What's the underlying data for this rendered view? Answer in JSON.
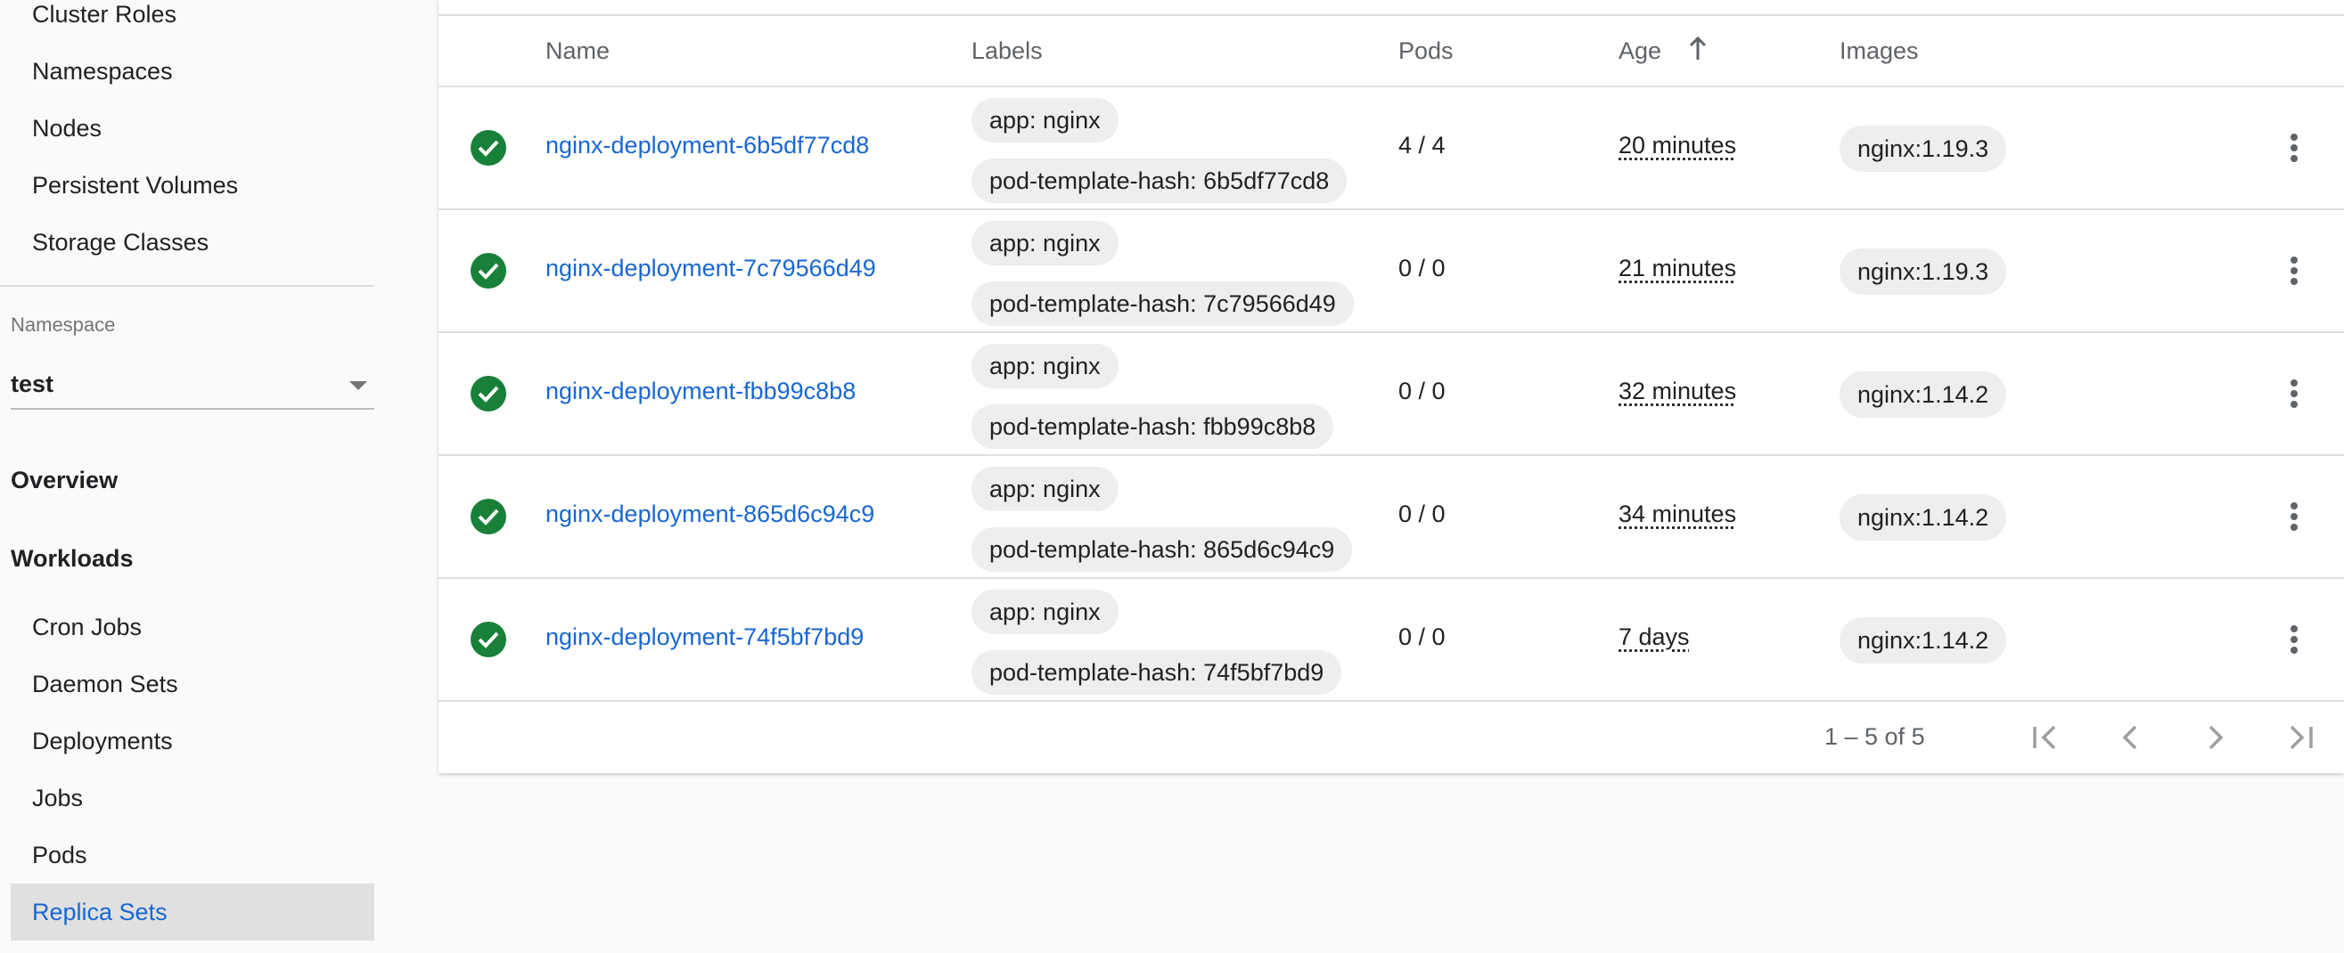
{
  "sidebar": {
    "cluster_items": [
      {
        "label": "Cluster Roles"
      },
      {
        "label": "Namespaces"
      },
      {
        "label": "Nodes"
      },
      {
        "label": "Persistent Volumes"
      },
      {
        "label": "Storage Classes"
      }
    ],
    "namespace_label": "Namespace",
    "namespace_value": "test",
    "overview_label": "Overview",
    "workloads_label": "Workloads",
    "workload_items": [
      {
        "label": "Cron Jobs"
      },
      {
        "label": "Daemon Sets"
      },
      {
        "label": "Deployments"
      },
      {
        "label": "Jobs"
      },
      {
        "label": "Pods"
      },
      {
        "label": "Replica Sets",
        "active": true
      }
    ]
  },
  "table": {
    "headers": {
      "name": "Name",
      "labels": "Labels",
      "pods": "Pods",
      "age": "Age",
      "images": "Images"
    },
    "sort_column": "Age",
    "sort_direction": "ascending",
    "rows": [
      {
        "status": "ok",
        "name": "nginx-deployment-6b5df77cd8",
        "labels": [
          "app: nginx",
          "pod-template-hash: 6b5df77cd8"
        ],
        "pods": "4 / 4",
        "age": "20 minutes",
        "image": "nginx:1.19.3"
      },
      {
        "status": "ok",
        "name": "nginx-deployment-7c79566d49",
        "labels": [
          "app: nginx",
          "pod-template-hash: 7c79566d49"
        ],
        "pods": "0 / 0",
        "age": "21 minutes",
        "image": "nginx:1.19.3"
      },
      {
        "status": "ok",
        "name": "nginx-deployment-fbb99c8b8",
        "labels": [
          "app: nginx",
          "pod-template-hash: fbb99c8b8"
        ],
        "pods": "0 / 0",
        "age": "32 minutes",
        "image": "nginx:1.14.2"
      },
      {
        "status": "ok",
        "name": "nginx-deployment-865d6c94c9",
        "labels": [
          "app: nginx",
          "pod-template-hash: 865d6c94c9"
        ],
        "pods": "0 / 0",
        "age": "34 minutes",
        "image": "nginx:1.14.2"
      },
      {
        "status": "ok",
        "name": "nginx-deployment-74f5bf7bd9",
        "labels": [
          "app: nginx",
          "pod-template-hash: 74f5bf7bd9"
        ],
        "pods": "0 / 0",
        "age": "7 days",
        "image": "nginx:1.14.2"
      }
    ]
  },
  "pagination": {
    "range": "1 – 5 of 5"
  },
  "colors": {
    "accent": "#1967d2",
    "success": "#188038",
    "chip_bg": "#eeeeee",
    "active_bg": "#e0e0e0"
  },
  "icons": {
    "status": "check-circle-icon",
    "sort": "arrow-upward-icon",
    "row_menu": "more-vert-icon",
    "first_page": "first-page-icon",
    "prev_page": "chevron-left-icon",
    "next_page": "chevron-right-icon",
    "last_page": "last-page-icon"
  }
}
